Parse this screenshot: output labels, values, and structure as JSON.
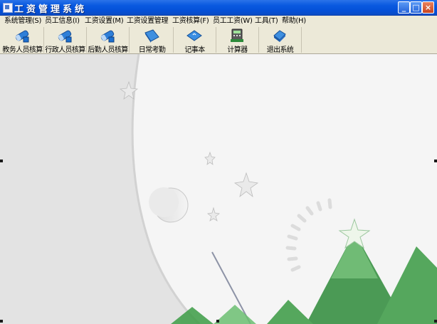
{
  "window": {
    "title": "工资管理系统",
    "buttons": {
      "minimize": "_",
      "maximize": "□",
      "close": "×"
    }
  },
  "menu": [
    {
      "label": "系统管理",
      "key": "(S)"
    },
    {
      "label": "员工信息",
      "key": "(I)"
    },
    {
      "label": "工资设置",
      "key": "(M)"
    },
    {
      "label": "工资设置管理",
      "key": ""
    },
    {
      "label": "工资核算",
      "key": "(F)"
    },
    {
      "label": "员工工资",
      "key": "(W)"
    },
    {
      "label": "工具",
      "key": "(T)"
    },
    {
      "label": "帮助",
      "key": "(H)"
    }
  ],
  "toolbar": [
    {
      "label": "教务人员核算",
      "icon": "eraser-icon"
    },
    {
      "label": "行政人员核算",
      "icon": "eraser-icon"
    },
    {
      "label": "后勤人员核算",
      "icon": "eraser-icon"
    },
    {
      "label": "日常考勤",
      "icon": "book-icon"
    },
    {
      "label": "记事本",
      "icon": "notebook-icon"
    },
    {
      "label": "计算器",
      "icon": "calculator-icon"
    },
    {
      "label": "退出系统",
      "icon": "exit-icon"
    }
  ],
  "colors": {
    "titlebar": "#0450d8",
    "menubar": "#ece9d8",
    "client_bg": "#f4f4f4",
    "tree_green": "#2e8b3a"
  }
}
